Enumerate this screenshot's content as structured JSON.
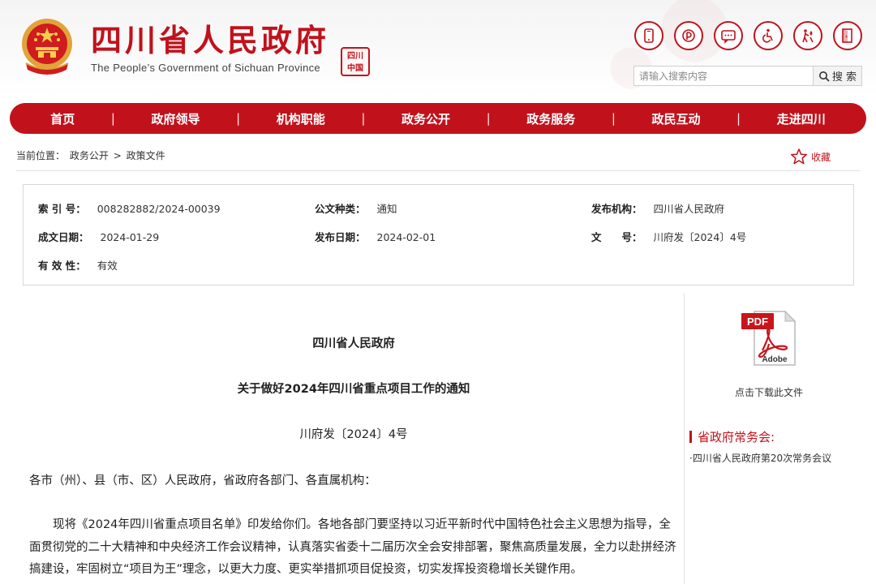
{
  "header": {
    "title": "四川省人民政府",
    "subtitle": "The People’s Government of Sichuan Province",
    "seal_text": "四川中国",
    "tool_icons": [
      "mobile-icon",
      "weibo-icon",
      "chat-icon",
      "accessibility-icon",
      "elderly-care-icon",
      "exit-icon"
    ],
    "search": {
      "placeholder": "请输入搜索内容",
      "button_label": "搜 索"
    },
    "accent_color": "#c1121c"
  },
  "nav": {
    "items": [
      "首页",
      "政府领导",
      "机构职能",
      "政务公开",
      "政务服务",
      "政民互动",
      "走进四川"
    ]
  },
  "breadcrumb": {
    "prefix": "当前位置：",
    "items": [
      "政务公开",
      "政策文件"
    ],
    "separator": ">"
  },
  "favorite_label": "收藏",
  "meta": {
    "index_label": "索 引 号：",
    "index_value": "008282882/2024-00039",
    "type_label": "公文种类：",
    "type_value": "通知",
    "issuer_label": "发布机构：",
    "issuer_value": "四川省人民政府",
    "created_label": "成文日期：",
    "created_value": "2024-01-29",
    "published_label": "发布日期：",
    "published_value": "2024-02-01",
    "docno_label": "文　　号：",
    "docno_value": "川府发〔2024〕4号",
    "validity_label": "有 效 性：",
    "validity_value": "有效"
  },
  "article": {
    "org": "四川省人民政府",
    "title": "关于做好2024年四川省重点项目工作的通知",
    "doc_number": "川府发〔2024〕4号",
    "address": "各市（州）、县（市、区）人民政府，省政府各部门、各直属机构：",
    "body": "现将《2024年四川省重点项目名单》印发给你们。各地各部门要坚持以习近平新时代中国特色社会主义思想为指导，全面贯彻党的二十大精神和中央经济工作会议精神，认真落实省委十二届历次全会安排部署，聚焦高质量发展，全力以赴拼经济搞建设，牢固树立“项目为王”理念，以更大力度、更实举措抓项目促投资，切实发挥投资稳增长关键作用。"
  },
  "sidebar": {
    "pdf_label": "PDF",
    "pdf_brand": "Adobe",
    "download_label": "点击下载此文件",
    "heading": "省政府常务会:",
    "link": "·四川省人民政府第20次常务会议"
  }
}
